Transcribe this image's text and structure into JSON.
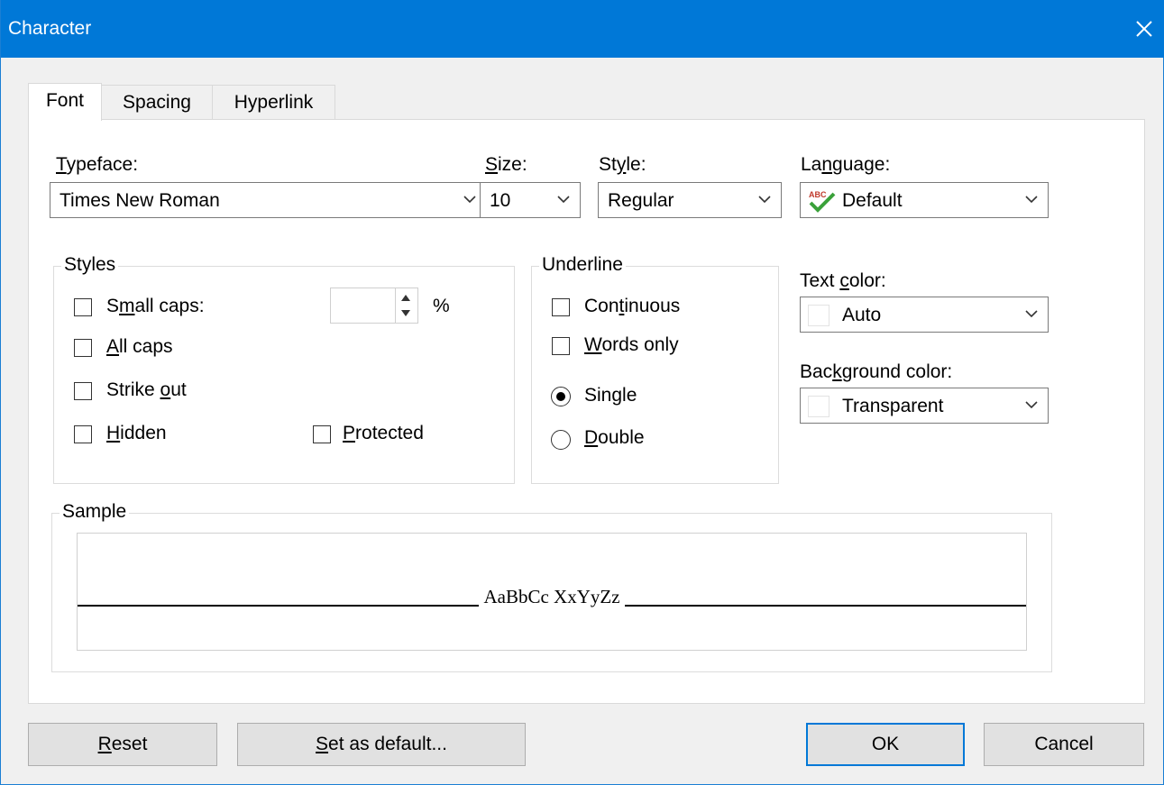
{
  "window": {
    "title": "Character"
  },
  "tabs": [
    {
      "label": "Font",
      "active": true
    },
    {
      "label": "Spacing",
      "active": false
    },
    {
      "label": "Hyperlink",
      "active": false
    }
  ],
  "fields": {
    "typeface": {
      "label_pre": "",
      "label_u": "T",
      "label_post": "ypeface:",
      "value": "Times New Roman"
    },
    "size": {
      "label_pre": "",
      "label_u": "S",
      "label_post": "ize:",
      "value": "10"
    },
    "style": {
      "label_pre": "St",
      "label_u": "y",
      "label_post": "le:",
      "value": "Regular"
    },
    "language": {
      "label_pre": "La",
      "label_u": "n",
      "label_post": "guage:",
      "value": "Default",
      "icon": "spellcheck-icon"
    }
  },
  "styles_group": {
    "title": "Styles",
    "small_caps": {
      "pre": "S",
      "u": "m",
      "post": "all caps:",
      "checked": false
    },
    "percent_value": "",
    "percent_unit": "%",
    "all_caps": {
      "pre": "",
      "u": "A",
      "post": "ll caps",
      "checked": false
    },
    "strike_out": {
      "pre": "Strike ",
      "u": "o",
      "post": "ut",
      "checked": false
    },
    "hidden": {
      "pre": "",
      "u": "H",
      "post": "idden",
      "checked": false
    },
    "protected": {
      "pre": "",
      "u": "P",
      "post": "rotected",
      "checked": false
    }
  },
  "underline_group": {
    "title": "Underline",
    "continuous": {
      "pre": "Con",
      "u": "t",
      "post": "inuous",
      "checked": false
    },
    "words_only": {
      "pre": "",
      "u": "W",
      "post": "ords only",
      "checked": false
    },
    "single": {
      "label": "Single",
      "selected": true
    },
    "double": {
      "pre": "",
      "u": "D",
      "post": "ouble",
      "selected": false
    }
  },
  "text_color": {
    "label_pre": "Text ",
    "label_u": "c",
    "label_post": "olor:",
    "value": "Auto"
  },
  "background_color": {
    "label_pre": "Bac",
    "label_u": "k",
    "label_post": "ground color:",
    "value": "Transparent"
  },
  "sample": {
    "title": "Sample",
    "text": "AaBbCc XxYyZz"
  },
  "buttons": {
    "reset": {
      "pre": "",
      "u": "R",
      "post": "eset"
    },
    "set_default": {
      "pre": "",
      "u": "S",
      "post": "et as default..."
    },
    "ok": "OK",
    "cancel": "Cancel"
  },
  "colors": {
    "titlebar": "#0078d7",
    "accent": "#0078d7",
    "spellcheck_green": "#3aa13a"
  }
}
